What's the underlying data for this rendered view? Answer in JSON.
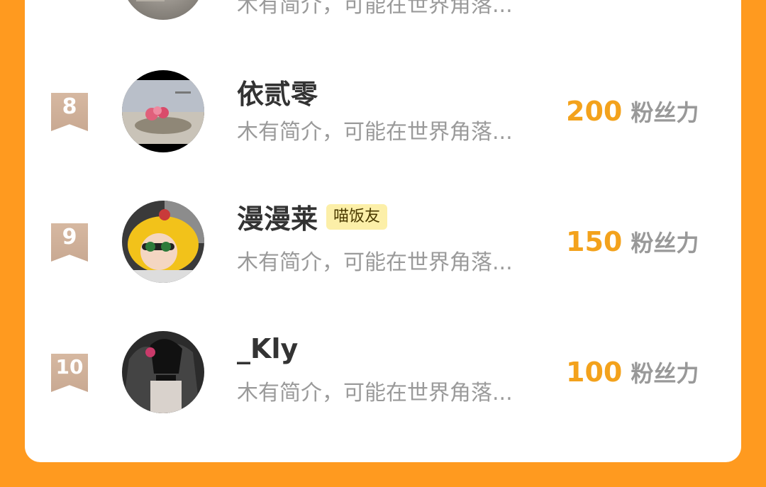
{
  "leaderboard": {
    "unit_label": "粉丝力",
    "top_partial": {
      "desc": "木有简介，可能在世界角落..."
    },
    "rows": [
      {
        "rank": "8",
        "name": "依贰零",
        "tag": "",
        "desc": "木有简介，可能在世界角落...",
        "score": "200"
      },
      {
        "rank": "9",
        "name": "漫漫莱",
        "tag": "喵饭友",
        "desc": "木有简介，可能在世界角落...",
        "score": "150"
      },
      {
        "rank": "10",
        "name": "_Kly",
        "tag": "",
        "desc": "木有简介，可能在世界角落...",
        "score": "100"
      }
    ]
  },
  "colors": {
    "background": "#FF9A1F",
    "score": "#F3A21C",
    "rank_badge": "#D0B09A",
    "tag_bg": "#FCEFA8"
  }
}
